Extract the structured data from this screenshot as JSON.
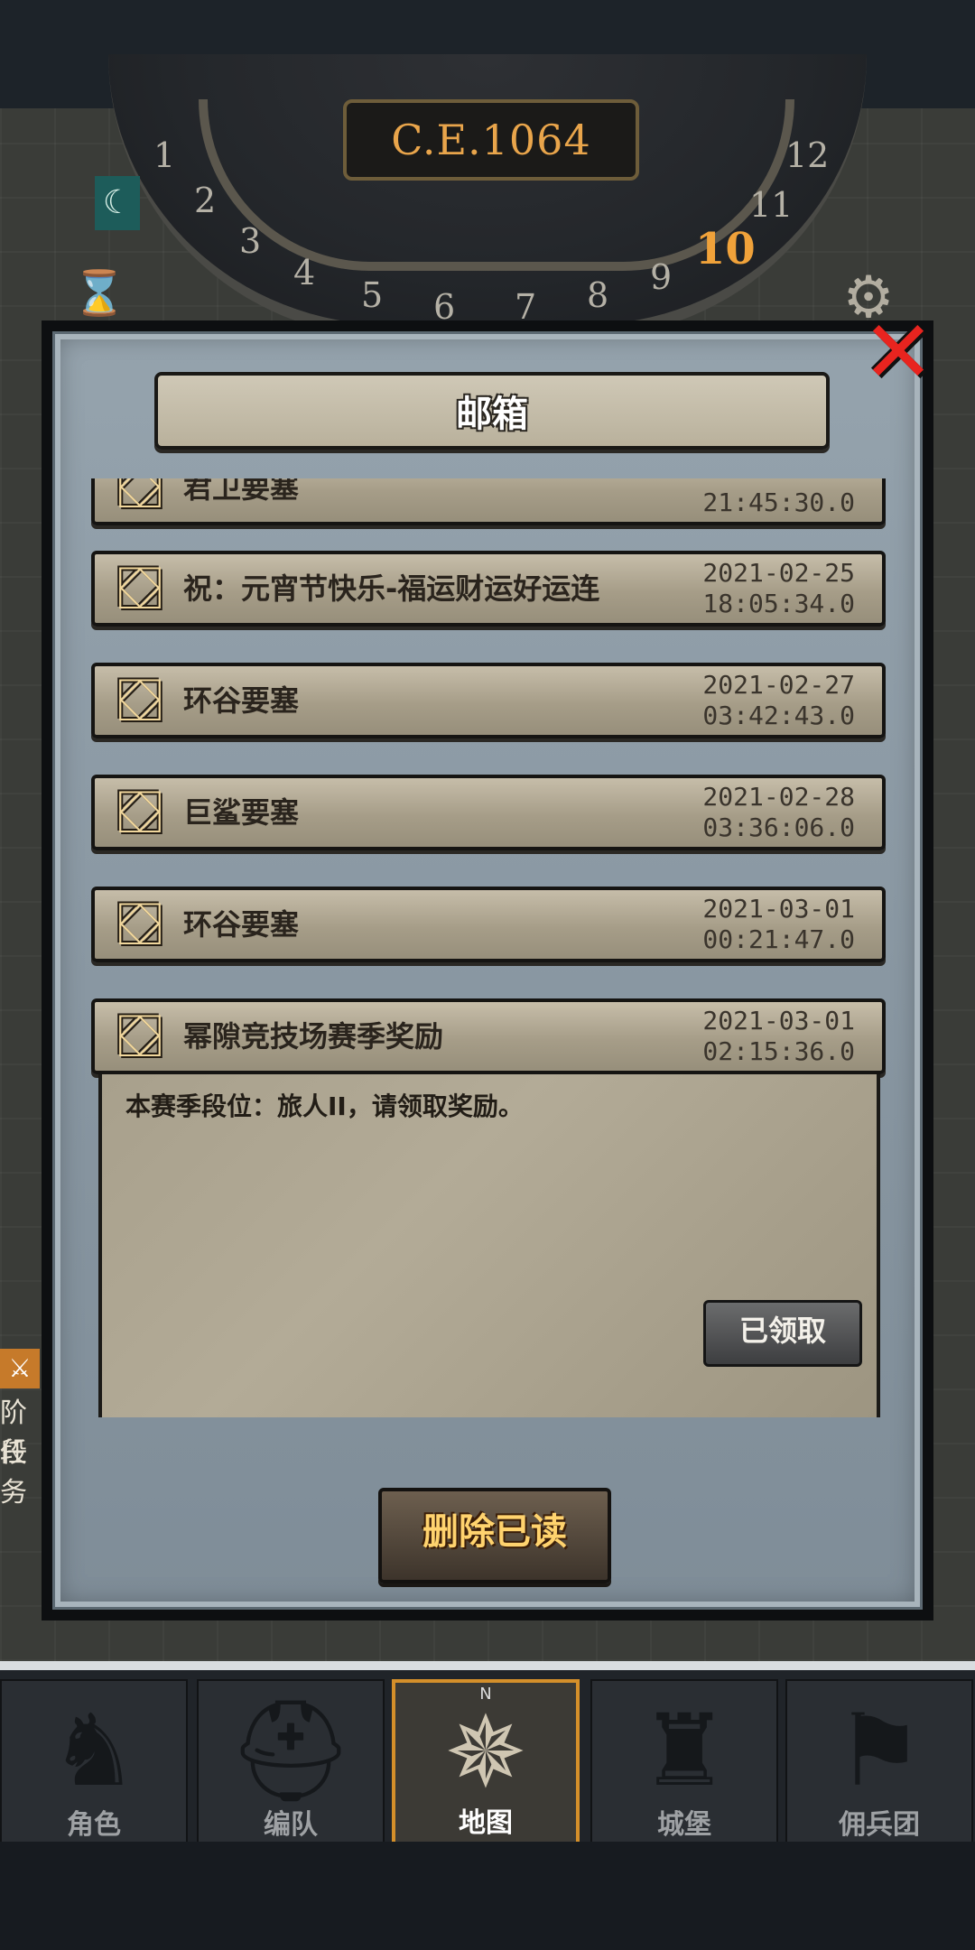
{
  "calendar": {
    "era": "C.E.1064",
    "months": [
      "1",
      "2",
      "3",
      "4",
      "5",
      "6",
      "7",
      "8",
      "9",
      "10",
      "11",
      "12"
    ],
    "current_month": "10"
  },
  "mailbox": {
    "title": "邮箱",
    "items": [
      {
        "subject": "君卫要塞",
        "date": "",
        "time": "21:45:30.0"
      },
      {
        "subject": "祝：元宵节快乐-福运财运好运连",
        "date": "2021-02-25",
        "time": "18:05:34.0"
      },
      {
        "subject": "环谷要塞",
        "date": "2021-02-27",
        "time": "03:42:43.0"
      },
      {
        "subject": "巨鲨要塞",
        "date": "2021-02-28",
        "time": "03:36:06.0"
      },
      {
        "subject": "环谷要塞",
        "date": "2021-03-01",
        "time": "00:21:47.0"
      },
      {
        "subject": "幂隙竞技场赛季奖励",
        "date": "2021-03-01",
        "time": "02:15:36.0"
      }
    ],
    "expanded_body": "本赛季段位：旅人II，请领取奖励。",
    "claimed_label": "已领取",
    "delete_read_label": "删除已读"
  },
  "side": {
    "label1": "阶段",
    "label2": "任务"
  },
  "nav": {
    "tabs": [
      {
        "label": "角色",
        "icon": "knight-icon"
      },
      {
        "label": "编队",
        "icon": "helmet-icon"
      },
      {
        "label": "地图",
        "icon": "compass-icon"
      },
      {
        "label": "城堡",
        "icon": "castle-icon"
      },
      {
        "label": "佣兵团",
        "icon": "banner-icon"
      }
    ],
    "active": "地图"
  },
  "colors": {
    "accent": "#d48f2a",
    "close": "#e8241f",
    "button_text": "#ffd36e"
  }
}
